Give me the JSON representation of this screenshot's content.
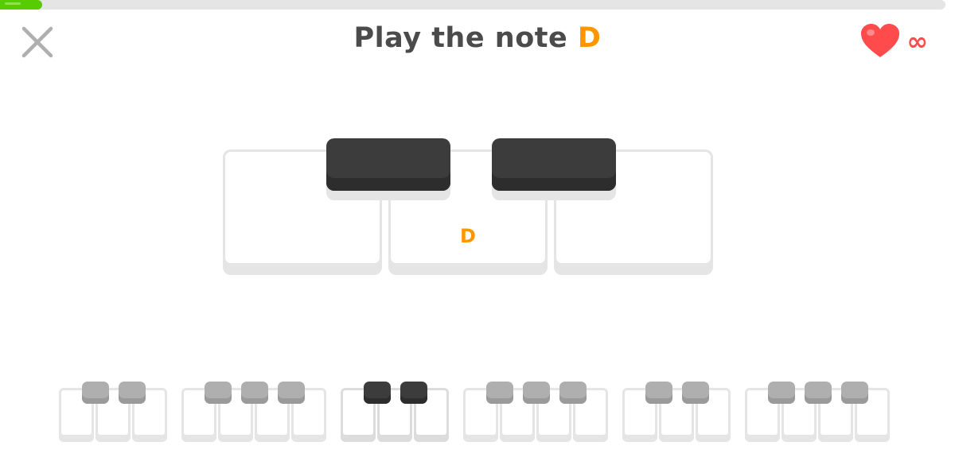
{
  "header": {
    "progress": 0.045,
    "progress_color": "#58cc02",
    "close_icon": "close-icon",
    "title_prefix": "Play the note ",
    "title_note": "D",
    "note_color": "#ff9600",
    "lives_icon": "heart-icon",
    "lives_value": "∞",
    "lives_color": "#ff4b4b"
  },
  "keyboard": {
    "white_keys": [
      {
        "label": ""
      },
      {
        "label": "D"
      },
      {
        "label": ""
      }
    ],
    "black_key_count": 2
  },
  "octave_selector": {
    "octaves": [
      {
        "white": 3,
        "black": 2,
        "active": false
      },
      {
        "white": 4,
        "black": 3,
        "active": false
      },
      {
        "white": 3,
        "black": 2,
        "active": true
      },
      {
        "white": 4,
        "black": 3,
        "active": false
      },
      {
        "white": 3,
        "black": 2,
        "active": false
      },
      {
        "white": 4,
        "black": 3,
        "active": false
      }
    ]
  }
}
